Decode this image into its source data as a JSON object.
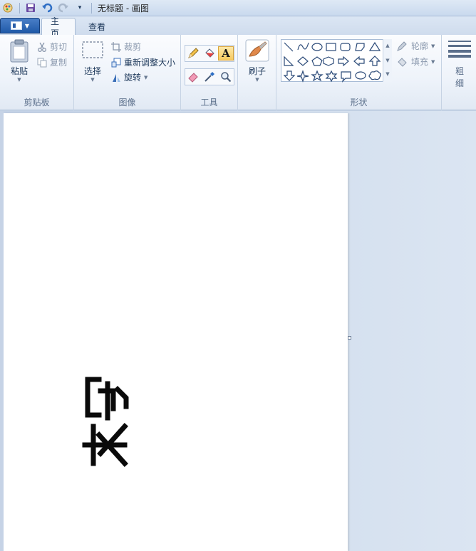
{
  "window": {
    "title": "无标题 - 画图"
  },
  "tabs": [
    {
      "label": "主页",
      "active": true
    },
    {
      "label": "查看",
      "active": false
    }
  ],
  "ribbon": {
    "clipboard": {
      "group_label": "剪贴板",
      "paste": "粘贴",
      "cut": "剪切",
      "copy": "复制"
    },
    "image": {
      "group_label": "图像",
      "select": "选择",
      "crop": "裁剪",
      "resize": "重新调整大小",
      "rotate": "旋转"
    },
    "tools": {
      "group_label": "工具",
      "icons": [
        "pencil-icon",
        "fill-bucket-icon",
        "text-icon",
        "eraser-icon",
        "color-picker-icon",
        "magnifier-icon"
      ],
      "text_glyph": "A"
    },
    "brushes": {
      "label": "刷子"
    },
    "shapes": {
      "group_label": "形状",
      "outline": "轮廓",
      "fill": "填充"
    },
    "size": {
      "label_line1": "粗",
      "label_line2": "细"
    }
  },
  "colors": {
    "accent": "#1f59a8",
    "ribbon_bg": "#eef3fa",
    "canvas": "#ffffff",
    "selected_tool": "#f7c95f"
  }
}
